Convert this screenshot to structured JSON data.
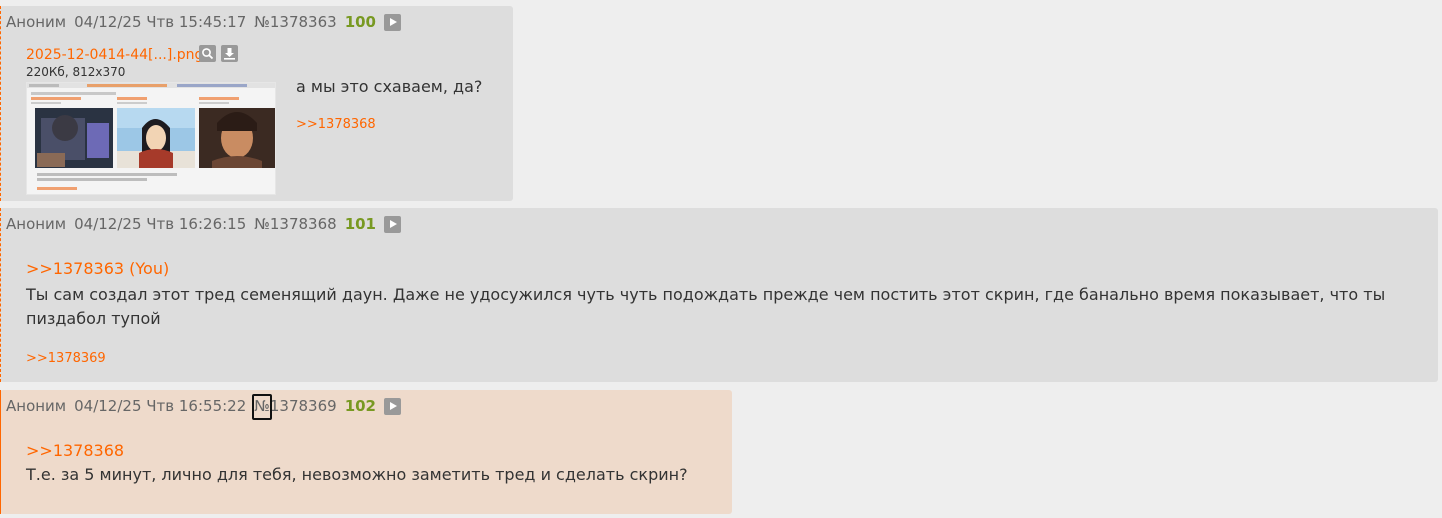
{
  "colors": {
    "page_bg": "#eeeeee",
    "post_bg": "#dddddd",
    "post_selected_bg": "#eedacb",
    "link": "#ff6600",
    "post_count": "#789922",
    "meta_text": "#666666",
    "body_text": "#333333"
  },
  "posts": [
    {
      "name": "Аноним",
      "datetime": "04/12/25 Чтв 15:45:17",
      "num_prefix": "№",
      "num": "1378363",
      "count": "100",
      "file": {
        "name": "2025-12-0414-44[...].png",
        "info": "220Кб, 812x370",
        "icons": [
          "search-icon",
          "download-icon"
        ]
      },
      "text": "а мы это схаваем, да?",
      "backlink": ">>1378368"
    },
    {
      "name": "Аноним",
      "datetime": "04/12/25 Чтв 16:26:15",
      "num_prefix": "№",
      "num": "1378368",
      "count": "101",
      "reply_to": ">>1378363 (You)",
      "text": "Ты сам создал этот тред семенящий даун. Даже не удосужился чуть чуть подождать прежде чем постить этот скрин, где банально время показывает, что ты пиздабол тупой",
      "backlink": ">>1378369"
    },
    {
      "name": "Аноним",
      "datetime": "04/12/25 Чтв 16:55:22",
      "num_prefix": "№",
      "num": "1378369",
      "count": "102",
      "reply_to": ">>1378368",
      "text": "Т.е. за 5 минут, лично для тебя, невозможно заметить тред и сделать скрин?"
    }
  ]
}
